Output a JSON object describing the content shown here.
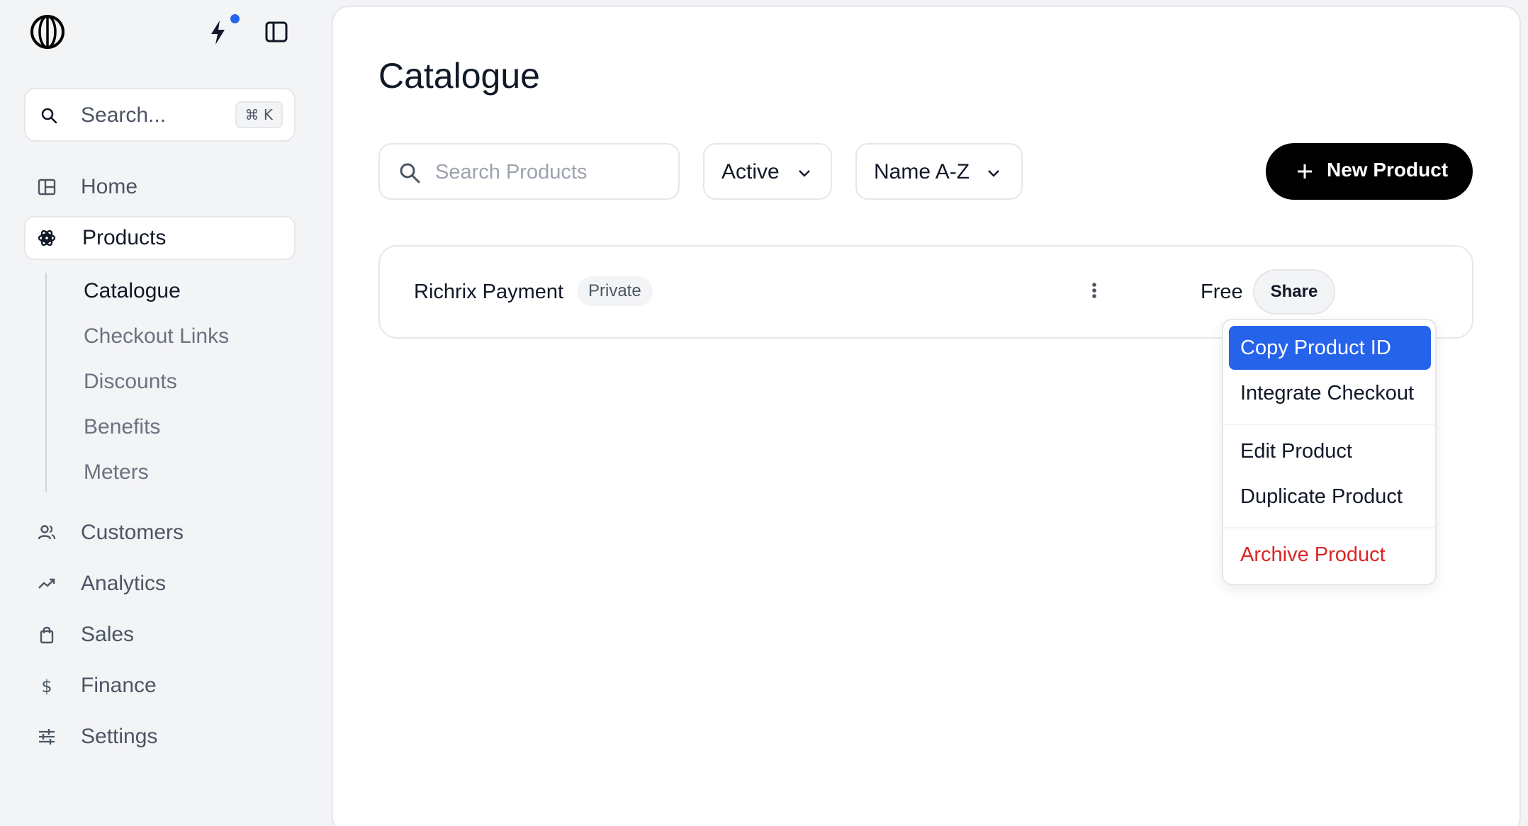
{
  "sidebar": {
    "search_placeholder": "Search...",
    "search_shortcut": "⌘ K",
    "nav": [
      {
        "label": "Home",
        "icon": "layout-icon"
      },
      {
        "label": "Products",
        "icon": "products-icon"
      },
      {
        "label": "Customers",
        "icon": "users-icon"
      },
      {
        "label": "Analytics",
        "icon": "trend-icon"
      },
      {
        "label": "Sales",
        "icon": "shopping-bag-icon"
      },
      {
        "label": "Finance",
        "icon": "dollar-icon"
      },
      {
        "label": "Settings",
        "icon": "sliders-icon"
      }
    ],
    "sub_nav": [
      "Catalogue",
      "Checkout Links",
      "Discounts",
      "Benefits",
      "Meters"
    ],
    "notification_color": "#2563eb"
  },
  "main": {
    "title": "Catalogue",
    "search_placeholder": "Search Products",
    "status_filter": "Active",
    "sort_filter": "Name A-Z",
    "new_product_label": "New Product",
    "products": [
      {
        "name": "Richrix Payment",
        "badge": "Private",
        "price": "Free",
        "share_label": "Share"
      }
    ]
  },
  "menu": {
    "items": [
      "Copy Product ID",
      "Integrate Checkout",
      "Edit Product",
      "Duplicate Product",
      "Archive Product"
    ],
    "highlight_color": "#2563eb",
    "danger_color": "#dc2626"
  }
}
